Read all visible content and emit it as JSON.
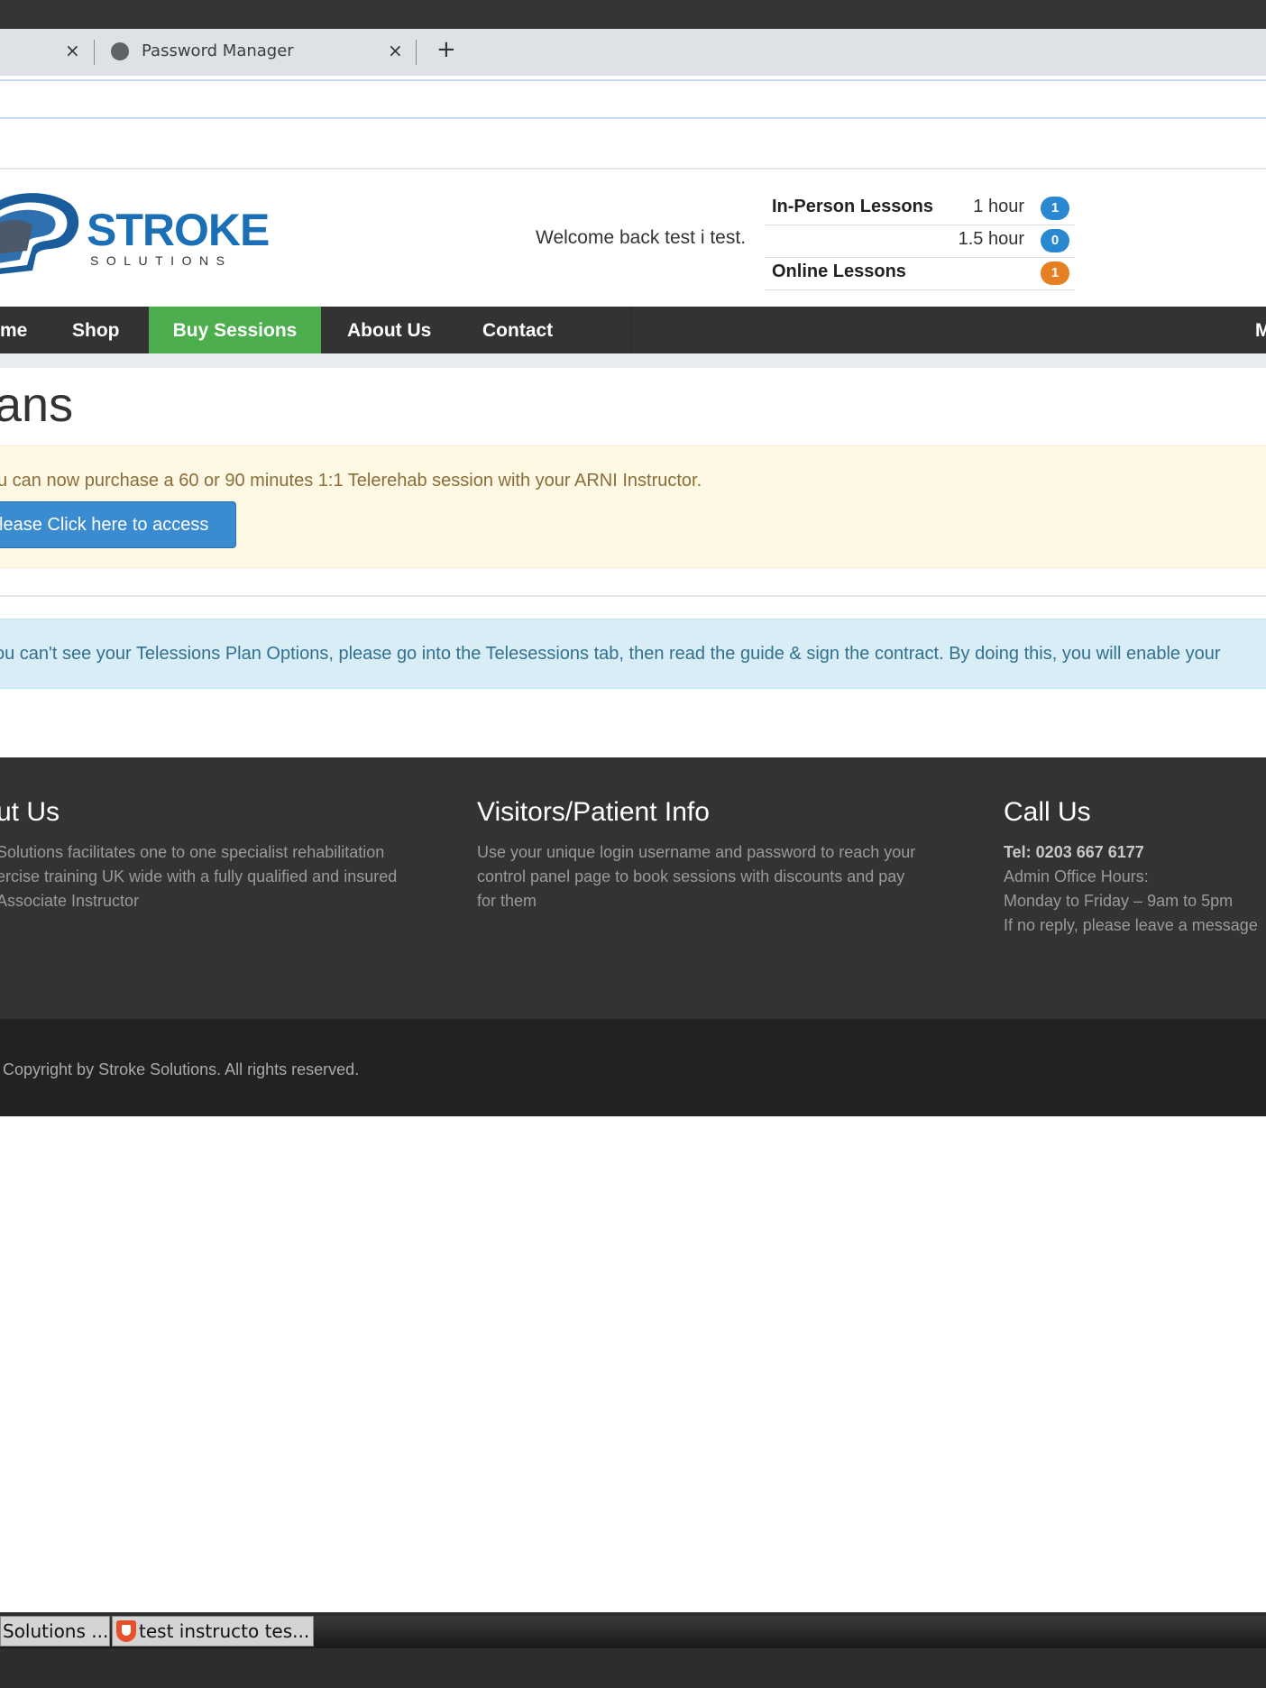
{
  "browser": {
    "tabs": [
      {
        "label": "",
        "close": "×"
      },
      {
        "label": "Password Manager",
        "close": "×"
      }
    ],
    "new_tab": "+"
  },
  "header": {
    "logo_word": "STROKE",
    "logo_sub": "SOLUTIONS",
    "welcome": "Welcome back test i test.",
    "lessons": [
      {
        "label": "In-Person Lessons",
        "duration": "1 hour",
        "count": "1",
        "color": "#2a88d1"
      },
      {
        "label": "",
        "duration": "1.5 hour",
        "count": "0",
        "color": "#2a88d1"
      },
      {
        "label": "Online Lessons",
        "duration": "",
        "count": "1",
        "color": "#e67e22"
      }
    ]
  },
  "nav": {
    "items": [
      "me",
      "Shop",
      "Buy Sessions",
      "About Us",
      "Contact"
    ],
    "right_item": "M"
  },
  "page": {
    "title": "ans",
    "warning_text": "u can now purchase a 60 or 90 minutes 1:1 Telerehab session with your ARNI Instructor.",
    "access_button": "lease Click here to access",
    "info_text": "ou can't see your Telessions Plan Options, please go into the Telesessions tab, then read the guide & sign the contract. By doing this, you will enable your"
  },
  "footer": {
    "about": {
      "heading": "ut Us",
      "lines": [
        "Solutions facilitates one to one specialist rehabilitation",
        "ercise training UK wide with a fully qualified and insured",
        "Associate Instructor"
      ]
    },
    "visitors": {
      "heading": "Visitors/Patient Info",
      "lines": [
        "Use your unique login username and password to reach your",
        "control panel page to book sessions with discounts and pay",
        "for them"
      ]
    },
    "call": {
      "heading": "Call Us",
      "tel": "Tel: 0203 667 6177",
      "lines": [
        "Admin Office Hours:",
        "Monday to Friday – 9am to 5pm",
        "If no reply, please leave a message"
      ]
    },
    "copyright": "Copyright by Stroke Solutions. All rights reserved."
  },
  "taskbar": {
    "items": [
      "Solutions ...",
      "test instructo tes..."
    ]
  }
}
